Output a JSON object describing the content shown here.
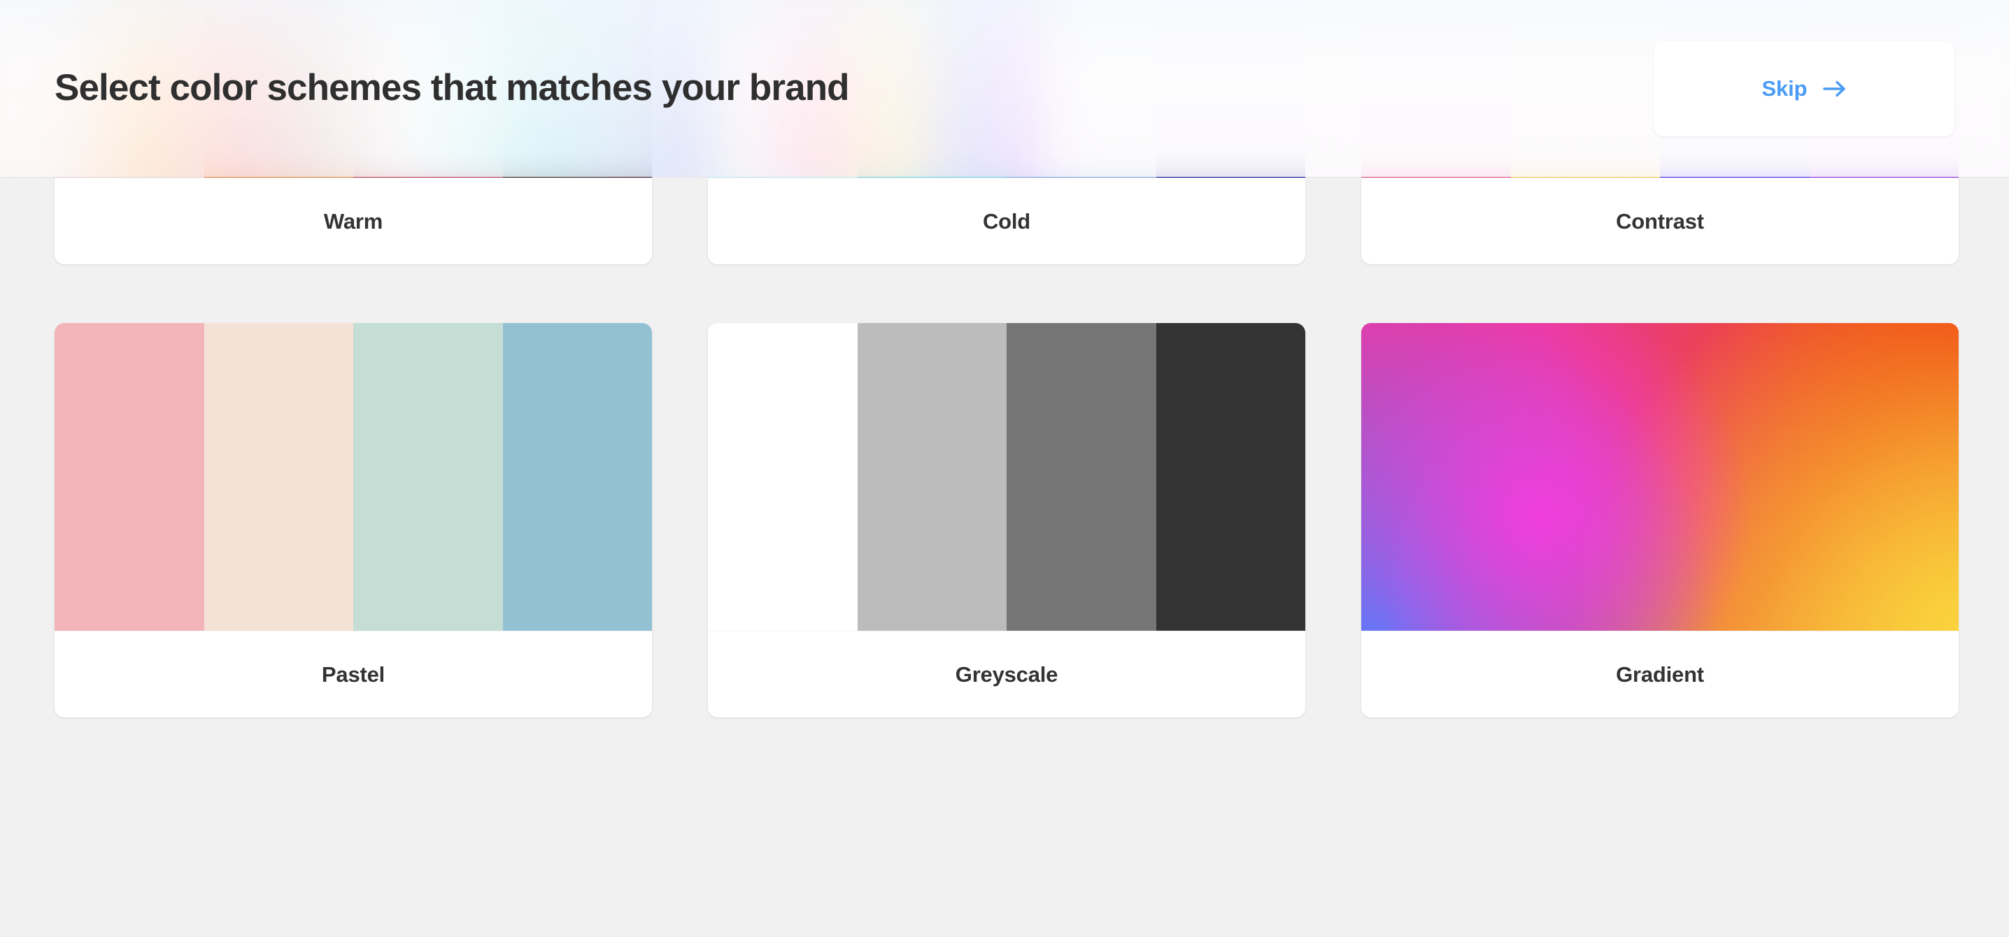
{
  "header": {
    "title": "Select color schemes that matches your brand",
    "skip_label": "Skip",
    "skip_icon": "arrow-right-icon",
    "accent_color": "#4a9bf5",
    "title_color": "#2f2f2f"
  },
  "page": {
    "background_color": "#f1f1f1",
    "card_background": "#ffffff",
    "label_color": "#333333"
  },
  "palettes": [
    {
      "name": "Warm",
      "type": "swatches",
      "colors": [
        "#f2e1e1",
        "#e98a38",
        "#c13551",
        "#35121c"
      ]
    },
    {
      "name": "Cold",
      "type": "swatches",
      "colors": [
        "#c9f6f9",
        "#69d8ec",
        "#7fa9e8",
        "#050a94"
      ]
    },
    {
      "name": "Contrast",
      "type": "swatches",
      "colors": [
        "#ec4b8c",
        "#f9d44f",
        "#3420ee",
        "#9327ec"
      ]
    },
    {
      "name": "Pastel",
      "type": "swatches",
      "colors": [
        "#f3b5b9",
        "#f5e2d7",
        "#c4ddd5",
        "#93c1d4"
      ]
    },
    {
      "name": "Greyscale",
      "type": "swatches",
      "colors": [
        "#ffffff",
        "#bcbcbc",
        "#757575",
        "#333333"
      ]
    },
    {
      "name": "Gradient",
      "type": "mesh",
      "colors": [
        "#ea38a6",
        "#ef3c10",
        "#f4d33d",
        "#6278f8",
        "#f43cde"
      ]
    }
  ]
}
